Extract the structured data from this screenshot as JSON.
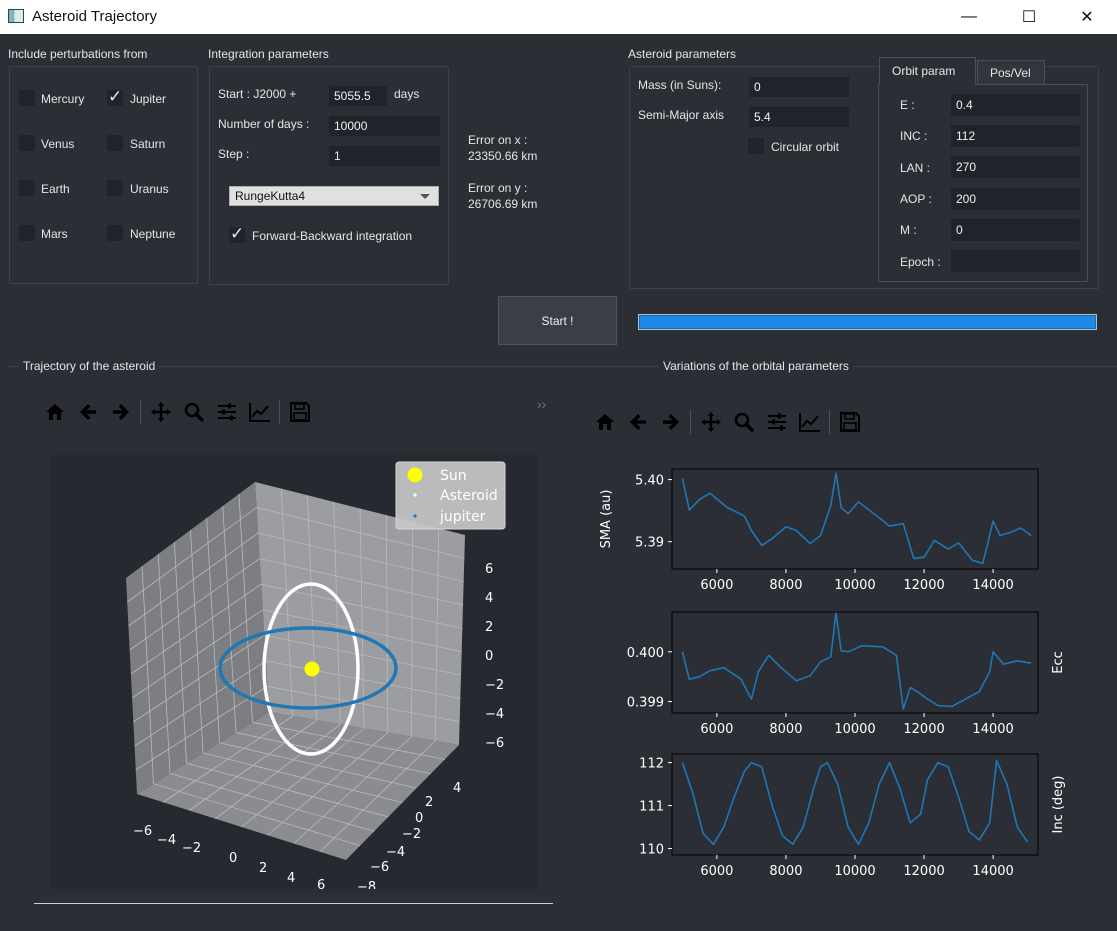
{
  "window": {
    "title": "Asteroid Trajectory",
    "minimize": "—",
    "maximize": "☐",
    "close": "✕"
  },
  "perturbations": {
    "title": "Include perturbations from",
    "planets": [
      {
        "label": "Mercury",
        "checked": false
      },
      {
        "label": "Jupiter",
        "checked": true
      },
      {
        "label": "Venus",
        "checked": false
      },
      {
        "label": "Saturn",
        "checked": false
      },
      {
        "label": "Earth",
        "checked": false
      },
      {
        "label": "Uranus",
        "checked": false
      },
      {
        "label": "Mars",
        "checked": false
      },
      {
        "label": "Neptune",
        "checked": false
      }
    ]
  },
  "integration": {
    "title": "Integration parameters",
    "start_label": "Start : J2000 +",
    "start_value": "5055.5",
    "start_unit": "days",
    "ndays_label": "Number of days :",
    "ndays_value": "10000",
    "step_label": "Step :",
    "step_value": "1",
    "method": "RungeKutta4",
    "fb_label": "Forward-Backward integration",
    "fb_checked": true
  },
  "errors": {
    "x_label": "Error on x :",
    "x_value": "23350.66 km",
    "y_label": "Error on y :",
    "y_value": "26706.69 km"
  },
  "asteroid": {
    "title": "Asteroid parameters",
    "mass_label": "Mass (in Suns):",
    "mass_value": "0",
    "sma_label": "Semi-Major axis",
    "sma_value": "5.4",
    "circular_label": "Circular orbit",
    "circular_checked": false
  },
  "orbit_tabs": {
    "active": "Orbit param",
    "other": "Pos/Vel"
  },
  "orbit_params": [
    {
      "label": "E :",
      "value": "0.4"
    },
    {
      "label": "INC :",
      "value": "112"
    },
    {
      "label": "LAN :",
      "value": "270"
    },
    {
      "label": "AOP :",
      "value": "200"
    },
    {
      "label": "M :",
      "value": "0"
    },
    {
      "label": "Epoch :",
      "value": ""
    }
  ],
  "start_button": "Start !",
  "progress": 1.0,
  "trajectory_panel": {
    "title": "Trajectory of the asteroid",
    "collapse": "››"
  },
  "variations_panel": {
    "title": "Variations of the orbital parameters"
  },
  "toolbar_icons": [
    "home-icon",
    "back-icon",
    "forward-icon",
    "pan-icon",
    "zoom-icon",
    "configure-icon",
    "edit-axes-icon",
    "save-icon"
  ],
  "colors": {
    "sun": "#ffff00",
    "asteroid": "#ffffff",
    "jupiter": "#1f77b4",
    "line": "#1f77b4",
    "plot_bg": "#2b2e35",
    "progress": "#1e88e5"
  },
  "chart_data": [
    {
      "type": "scatter",
      "title": "",
      "legend": [
        "Sun",
        "Asteroid",
        "jupiter"
      ],
      "legend_position": "top-right",
      "x_ticks": [
        "−6",
        "−4",
        "−2",
        "0",
        "2",
        "4",
        "6"
      ],
      "y_ticks": [
        "−8",
        "−6",
        "−4",
        "−2",
        "0",
        "2",
        "4"
      ],
      "z_ticks": [
        "6",
        "4",
        "2",
        "0",
        "−2",
        "−4",
        "−6"
      ],
      "series": [
        {
          "name": "Sun",
          "x": [
            0
          ],
          "y": [
            0
          ],
          "z": [
            0
          ]
        },
        {
          "name": "Asteroid",
          "orbit": "ellipse",
          "semi_major_axis": 5.4,
          "eccentricity": 0.4
        },
        {
          "name": "jupiter",
          "orbit": "ellipse",
          "semi_major_axis": 5.2
        }
      ]
    },
    {
      "type": "line",
      "ylabel": "SMA (au)",
      "x_ticks": [
        "6000",
        "8000",
        "10000",
        "12000",
        "14000"
      ],
      "y_ticks": [
        "5.40",
        "5.39"
      ],
      "xlim": [
        4700,
        15300
      ],
      "ylim": [
        5.3856,
        5.4017
      ],
      "x": [
        5000,
        5200,
        5500,
        5800,
        6300,
        6800,
        7000,
        7300,
        7600,
        8000,
        8300,
        8700,
        9000,
        9300,
        9450,
        9600,
        9800,
        10100,
        10600,
        11000,
        11400,
        11700,
        12000,
        12300,
        12700,
        13000,
        13400,
        13700,
        14000,
        14200,
        14500,
        14800,
        15100
      ],
      "values": [
        5.4002,
        5.3951,
        5.3968,
        5.3978,
        5.3955,
        5.3941,
        5.3918,
        5.3894,
        5.3905,
        5.3924,
        5.3918,
        5.3897,
        5.391,
        5.3958,
        5.401,
        5.3955,
        5.3945,
        5.3964,
        5.3943,
        5.3925,
        5.3929,
        5.3873,
        5.3875,
        5.3902,
        5.3888,
        5.3898,
        5.387,
        5.3865,
        5.3933,
        5.391,
        5.3915,
        5.3922,
        5.391
      ]
    },
    {
      "type": "line",
      "ylabel": "Ecc",
      "x_ticks": [
        "6000",
        "8000",
        "10000",
        "12000",
        "14000"
      ],
      "y_ticks": [
        "0.400",
        "0.399"
      ],
      "xlim": [
        4700,
        15300
      ],
      "ylim": [
        0.39877,
        0.4008
      ],
      "x": [
        5000,
        5200,
        5500,
        5800,
        6200,
        6700,
        7000,
        7200,
        7500,
        7800,
        8300,
        8700,
        9000,
        9300,
        9450,
        9600,
        9800,
        10200,
        10800,
        11200,
        11400,
        11600,
        11800,
        12100,
        12400,
        12800,
        13200,
        13600,
        13900,
        14000,
        14300,
        14700,
        15100
      ],
      "values": [
        0.4,
        0.39945,
        0.3995,
        0.39962,
        0.39968,
        0.39945,
        0.39905,
        0.3996,
        0.39993,
        0.39972,
        0.39942,
        0.39952,
        0.3998,
        0.3999,
        0.40078,
        0.40002,
        0.4,
        0.40012,
        0.4001,
        0.39993,
        0.39885,
        0.39928,
        0.3992,
        0.39905,
        0.39892,
        0.3989,
        0.39905,
        0.3992,
        0.3996,
        0.4,
        0.39975,
        0.39982,
        0.39977
      ]
    },
    {
      "type": "line",
      "ylabel": "Inc (deg)",
      "x_ticks": [
        "6000",
        "8000",
        "10000",
        "12000",
        "14000"
      ],
      "y_ticks": [
        "112",
        "111",
        "110"
      ],
      "xlim": [
        4700,
        15300
      ],
      "ylim": [
        109.85,
        112.2
      ],
      "x": [
        5000,
        5300,
        5600,
        5900,
        6200,
        6500,
        6800,
        7000,
        7300,
        7600,
        7900,
        8200,
        8500,
        8800,
        9000,
        9200,
        9500,
        9800,
        10100,
        10400,
        10700,
        11000,
        11300,
        11600,
        11900,
        12100,
        12400,
        12700,
        13000,
        13300,
        13600,
        13900,
        14100,
        14400,
        14700,
        15000
      ],
      "values": [
        112.0,
        111.3,
        110.35,
        110.1,
        110.5,
        111.2,
        111.8,
        112.0,
        111.9,
        111.0,
        110.3,
        110.1,
        110.5,
        111.4,
        111.9,
        112.0,
        111.5,
        110.5,
        110.1,
        110.6,
        111.5,
        112.0,
        111.4,
        110.6,
        110.8,
        111.6,
        112.0,
        111.9,
        111.2,
        110.4,
        110.2,
        110.6,
        112.05,
        111.5,
        110.5,
        110.15
      ]
    }
  ]
}
